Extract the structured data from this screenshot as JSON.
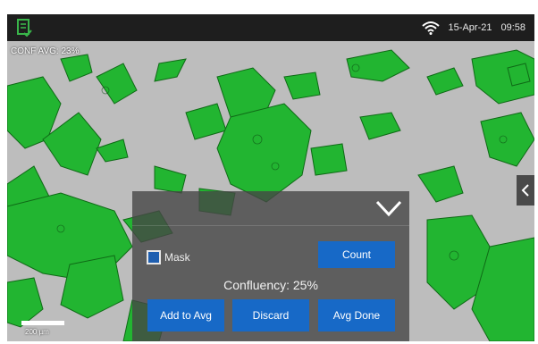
{
  "statusbar": {
    "date": "15-Apr-21",
    "time": "09:58"
  },
  "overlay": {
    "conf_avg": "CONF AVG: 23%",
    "scale_label": "200 µm"
  },
  "panel": {
    "mask_label": "Mask",
    "mask_checked": false,
    "count_label": "Count",
    "confluency_text": "Confluency: 25%",
    "add_to_avg_label": "Add to Avg",
    "discard_label": "Discard",
    "avg_done_label": "Avg Done"
  },
  "colors": {
    "accent": "#1769c7",
    "mask_green": "#1fbf2a",
    "logo_green": "#39b54a"
  },
  "icons": {
    "logo": "document-check-icon",
    "wifi": "wifi-icon",
    "collapse": "chevron-down-icon",
    "side": "chevron-left-icon"
  }
}
